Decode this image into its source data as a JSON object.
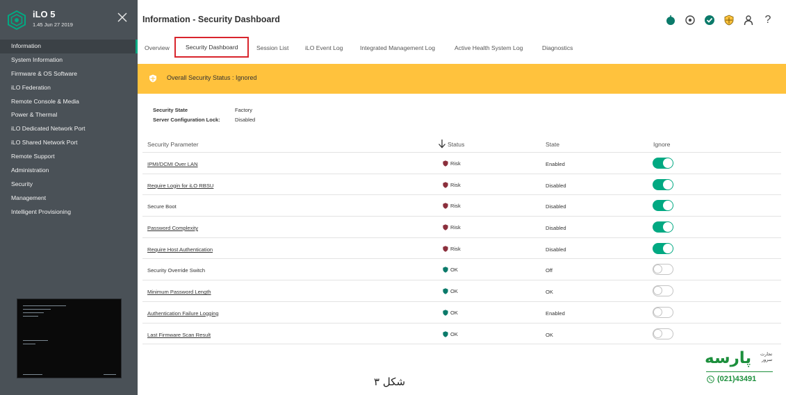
{
  "app": {
    "title": "iLO 5",
    "version": "1.45 Jun 27 2019"
  },
  "sidebar": {
    "items": [
      {
        "label": "Information",
        "active": true
      },
      {
        "label": "System Information"
      },
      {
        "label": "Firmware & OS Software"
      },
      {
        "label": "iLO Federation"
      },
      {
        "label": "Remote Console & Media"
      },
      {
        "label": "Power & Thermal"
      },
      {
        "label": "iLO Dedicated Network Port"
      },
      {
        "label": "iLO Shared Network Port"
      },
      {
        "label": "Remote Support"
      },
      {
        "label": "Administration"
      },
      {
        "label": "Security"
      },
      {
        "label": "Management"
      },
      {
        "label": "Intelligent Provisioning"
      }
    ]
  },
  "header": {
    "title": "Information - Security Dashboard",
    "icons": [
      "power-icon",
      "location-target-icon",
      "health-ok-icon",
      "security-shield-icon",
      "user-icon",
      "help-icon"
    ],
    "help_glyph": "?"
  },
  "tabs": [
    {
      "label": "Overview"
    },
    {
      "label": "Security Dashboard",
      "active": true
    },
    {
      "label": "Session List"
    },
    {
      "label": "iLO Event Log"
    },
    {
      "label": "Integrated Management Log"
    },
    {
      "label": "Active Health System Log"
    },
    {
      "label": "Diagnostics"
    }
  ],
  "banner": {
    "text": "Overall Security Status : Ignored",
    "color": "#ffc23d"
  },
  "state": {
    "security_state_label": "Security State",
    "security_state_value": "Factory",
    "config_lock_label": "Server Configuration Lock:",
    "config_lock_value": "Disabled"
  },
  "table": {
    "headers": {
      "parameter": "Security Parameter",
      "status": "Status",
      "state": "State",
      "ignore": "Ignore"
    },
    "rows": [
      {
        "parameter": "IPMI/DCMI Over LAN",
        "link": true,
        "status": "Risk",
        "state": "Enabled",
        "ignore": true
      },
      {
        "parameter": "Require Login for iLO RBSU",
        "link": true,
        "status": "Risk",
        "state": "Disabled",
        "ignore": true
      },
      {
        "parameter": "Secure Boot",
        "link": false,
        "status": "Risk",
        "state": "Disabled",
        "ignore": true
      },
      {
        "parameter": "Password Complexity",
        "link": true,
        "status": "Risk",
        "state": "Disabled",
        "ignore": true
      },
      {
        "parameter": "Require Host Authentication",
        "link": true,
        "status": "Risk",
        "state": "Disabled",
        "ignore": true
      },
      {
        "parameter": "Security Override Switch",
        "link": false,
        "status": "OK",
        "state": "Off",
        "ignore": false
      },
      {
        "parameter": "Minimum Password Length",
        "link": true,
        "status": "OK",
        "state": "OK",
        "ignore": false
      },
      {
        "parameter": "Authentication Failure Logging",
        "link": true,
        "status": "OK",
        "state": "Enabled",
        "ignore": false
      },
      {
        "parameter": "Last Firmware Scan Result",
        "link": true,
        "status": "OK",
        "state": "OK",
        "ignore": false
      }
    ]
  },
  "colors": {
    "accent": "#01a982",
    "risk": "#8b2f3c",
    "ok": "#0b7a6a",
    "highlight_box": "#d8242c"
  },
  "caption": "شکل ۳",
  "watermark": {
    "brand": "پارسه",
    "sub_line1": "تجارت",
    "sub_line2": "سرور",
    "phone": "(021)43491"
  }
}
